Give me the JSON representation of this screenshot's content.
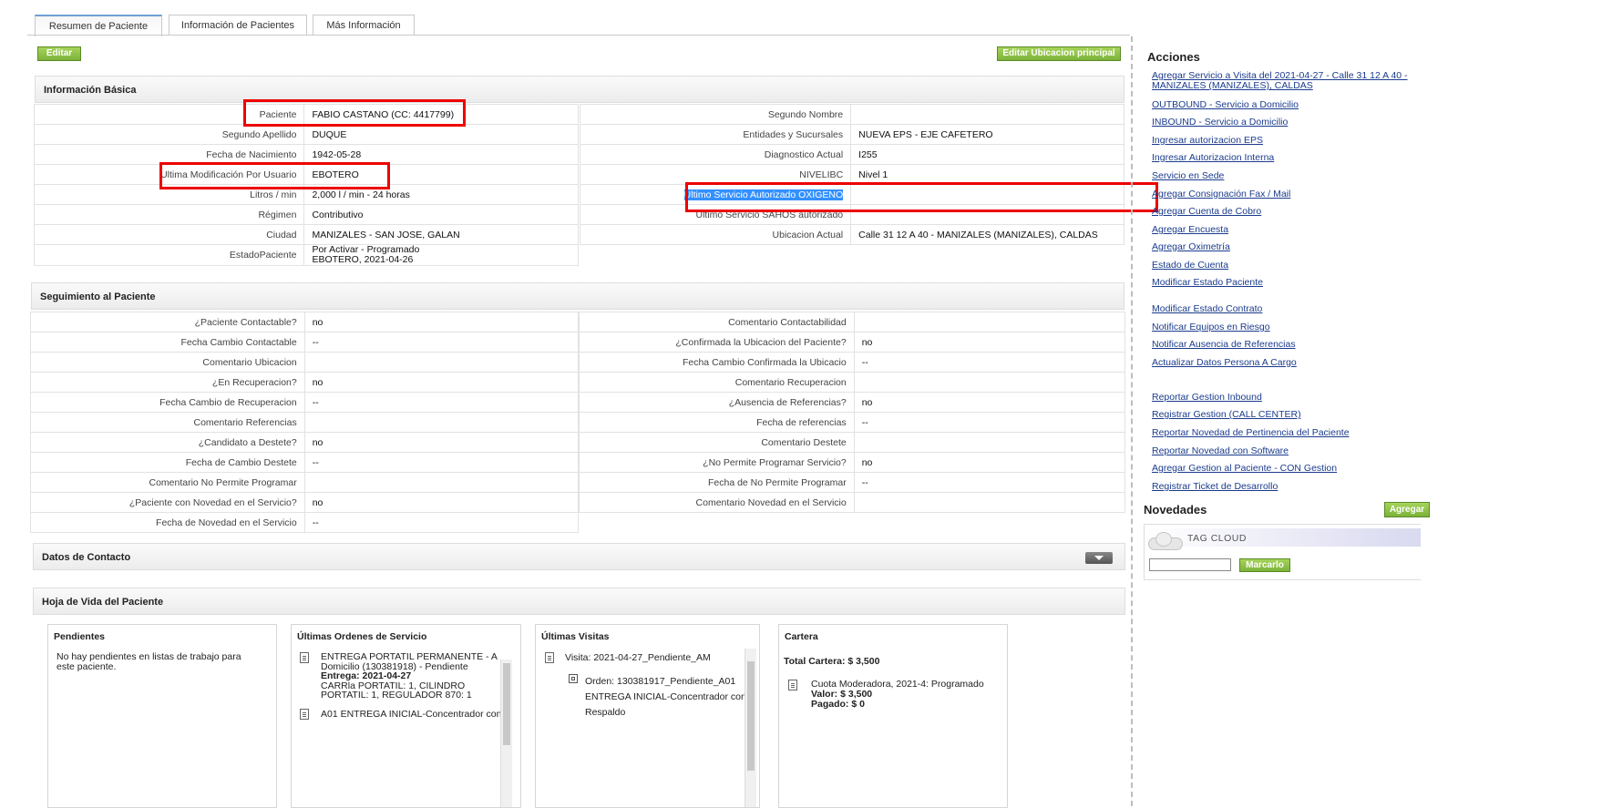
{
  "tabs": [
    "Resumen de Paciente",
    "Información de Pacientes",
    "Más Información"
  ],
  "buttons": {
    "editar": "Editar",
    "editar_ubicacion": "Editar Ubicacion principal",
    "agregar": "Agregar",
    "marcarlo": "Marcarlo"
  },
  "basic": {
    "title": "Información Básica",
    "left": [
      [
        "Paciente",
        "FABIO CASTANO (CC: 4417799)"
      ],
      [
        "Segundo Apellido",
        "DUQUE"
      ],
      [
        "Fecha de Nacimiento",
        "1942-05-28"
      ],
      [
        "Ultima Modificación Por Usuario",
        "EBOTERO"
      ],
      [
        "Litros / min",
        "2,000 l / min - 24 horas"
      ],
      [
        "Régimen",
        "Contributivo"
      ],
      [
        "Ciudad",
        "MANIZALES - SAN JOSE, GALAN"
      ],
      [
        "EstadoPaciente",
        "Por Activar - Programado",
        "EBOTERO, 2021-04-26"
      ]
    ],
    "right": [
      [
        "Segundo Nombre",
        ""
      ],
      [
        "Entidades y Sucursales",
        "NUEVA EPS - EJE CAFETERO"
      ],
      [
        "Diagnostico Actual",
        "I255"
      ],
      [
        "NIVELIBC",
        "Nivel 1"
      ],
      [
        "Ultimo Servicio Autorizado OXIGENO",
        ""
      ],
      [
        "Ultimo Servicio SAHOS autorizado",
        ""
      ],
      [
        "Ubicacion Actual",
        "Calle 31 12 A 40 - MANIZALES (MANIZALES), CALDAS"
      ]
    ]
  },
  "seguimiento": {
    "title": "Seguimiento al Paciente",
    "left": [
      [
        "¿Paciente Contactable?",
        "no"
      ],
      [
        "Fecha Cambio Contactable",
        "--"
      ],
      [
        "Comentario Ubicacion",
        ""
      ],
      [
        "¿En Recuperacion?",
        "no"
      ],
      [
        "Fecha Cambio de Recuperacion",
        "--"
      ],
      [
        "Comentario Referencias",
        ""
      ],
      [
        "¿Candidato a Destete?",
        "no"
      ],
      [
        "Fecha de Cambio Destete",
        "--"
      ],
      [
        "Comentario No Permite Programar",
        ""
      ],
      [
        "¿Paciente con Novedad en el Servicio?",
        "no"
      ],
      [
        "Fecha de Novedad en el Servicio",
        "--"
      ]
    ],
    "right": [
      [
        "Comentario Contactabilidad",
        ""
      ],
      [
        "¿Confirmada la Ubicacion del Paciente?",
        "no"
      ],
      [
        "Fecha Cambio Confirmada la Ubicacio",
        "--"
      ],
      [
        "Comentario Recuperacion",
        ""
      ],
      [
        "¿Ausencia de Referencias?",
        "no"
      ],
      [
        "Fecha de referencias",
        "--"
      ],
      [
        "Comentario Destete",
        ""
      ],
      [
        "¿No Permite Programar Servicio?",
        "no"
      ],
      [
        "Fecha de No Permite Programar",
        "--"
      ],
      [
        "Comentario Novedad en el Servicio",
        ""
      ]
    ]
  },
  "contacto": {
    "title": "Datos de Contacto"
  },
  "hoja": {
    "title": "Hoja de Vida del Paciente",
    "pendientes": {
      "title": "Pendientes",
      "text": "No hay pendientes en listas de trabajo para este paciente."
    },
    "ordenes": {
      "title": "Últimas Ordenes de Servicio",
      "item1_line1": "ENTREGA PORTATIL PERMANENTE - A",
      "item1_line2": "Domicilio (130381918) - Pendiente",
      "item1_entrega_label": "Entrega:",
      "item1_entrega_val": "2021-04-27",
      "item1_line4": "CARRla PORTATIL: 1, CILINDRO",
      "item1_line5": "PORTATIL: 1, REGULADOR 870: 1",
      "item2_line1": "A01 ENTREGA INICIAL-Concentrador con"
    },
    "visitas": {
      "title": "Últimas Visitas",
      "visita": "Visita: 2021-04-27_Pendiente_AM",
      "orden": "Orden: 130381917_Pendiente_A01",
      "orden_line2": "ENTREGA INICIAL-Concentrador con",
      "orden_line3": "Respaldo"
    },
    "cartera": {
      "title": "Cartera",
      "total": "Total Cartera: $ 3,500",
      "cuota": "Cuota Moderadora, 2021-4: Programado",
      "valor": "Valor: $ 3,500",
      "pagado": "Pagado: $ 0"
    }
  },
  "acciones": {
    "title": "Acciones",
    "links": [
      [
        "Agregar Servicio a Visita del 2021-04-27 - Calle 31 12 A 40 -",
        "MANIZALES (MANIZALES), CALDAS"
      ],
      [
        "OUTBOUND - Servicio a Domicilio"
      ],
      [
        "INBOUND - Servicio a Domicilio"
      ],
      [
        "Ingresar autorizacion EPS"
      ],
      [
        "Ingresar Autorizacion Interna"
      ],
      [
        "Servicio en Sede"
      ],
      [
        "Agregar Consignación Fax / Mail"
      ],
      [
        "Agregar Cuenta de Cobro"
      ],
      [
        "Agregar Encuesta"
      ],
      [
        "Agregar Oximetría"
      ],
      [
        "Estado de Cuenta"
      ],
      [
        "Modificar Estado Paciente"
      ],
      [
        "Modificar Estado Contrato"
      ],
      [
        "Notificar Equipos en Riesgo"
      ],
      [
        "Notificar Ausencia de Referencias"
      ],
      [
        "Actualizar Datos Persona A Cargo"
      ],
      [
        "Reportar Gestion Inbound"
      ],
      [
        "Registrar Gestion (CALL CENTER)"
      ],
      [
        "Reportar Novedad de Pertinencia del Paciente"
      ],
      [
        "Reportar Novedad con Software"
      ],
      [
        "Agregar Gestion al Paciente - CON Gestion"
      ],
      [
        "Registrar Ticket de Desarrollo"
      ]
    ]
  },
  "novedades": {
    "title": "Novedades",
    "tag_cloud": "TAG CLOUD",
    "input_value": ""
  }
}
